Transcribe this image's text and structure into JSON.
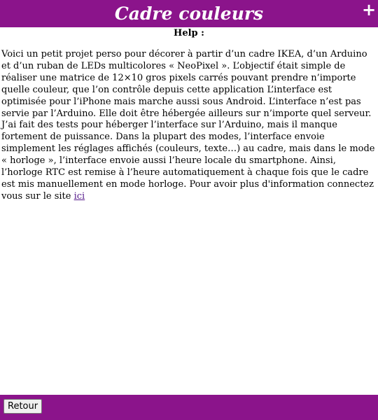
{
  "header": {
    "title": "Cadre couleurs",
    "add_label": "+"
  },
  "help": {
    "heading": "Help :",
    "body_text": "Voici un petit projet perso pour décorer à partir d’un cadre IKEA, d’un Arduino et d’un ruban de LEDs multicolores « NeoPixel ». L’objectif était simple de réaliser une matrice de 12×10 gros pixels carrés pouvant prendre n’importe quelle couleur, que l’on contrôle depuis cette application L’interface est optimisée pour l’iPhone mais marche aussi sous Android. L’interface n’est pas servie par l’Arduino. Elle doit être hébergée ailleurs sur n’importe quel serveur. J’ai fait des tests pour héberger l’interface sur l’Arduino, mais il manque fortement de puissance. Dans la plupart des modes, l’interface envoie simplement les réglages affichés (couleurs, texte…) au cadre, mais dans le mode « horloge », l’interface envoie aussi l’heure locale du smartphone. Ainsi, l’horloge RTC est remise à l’heure automatiquement à chaque fois que le cadre est mis manuellement en mode horloge. Pour avoir plus d'information connectez vous sur le site ",
    "link_label": "ici"
  },
  "footer": {
    "back_label": "Retour"
  },
  "colors": {
    "accent": "#8b148b",
    "link": "#551a8b"
  }
}
